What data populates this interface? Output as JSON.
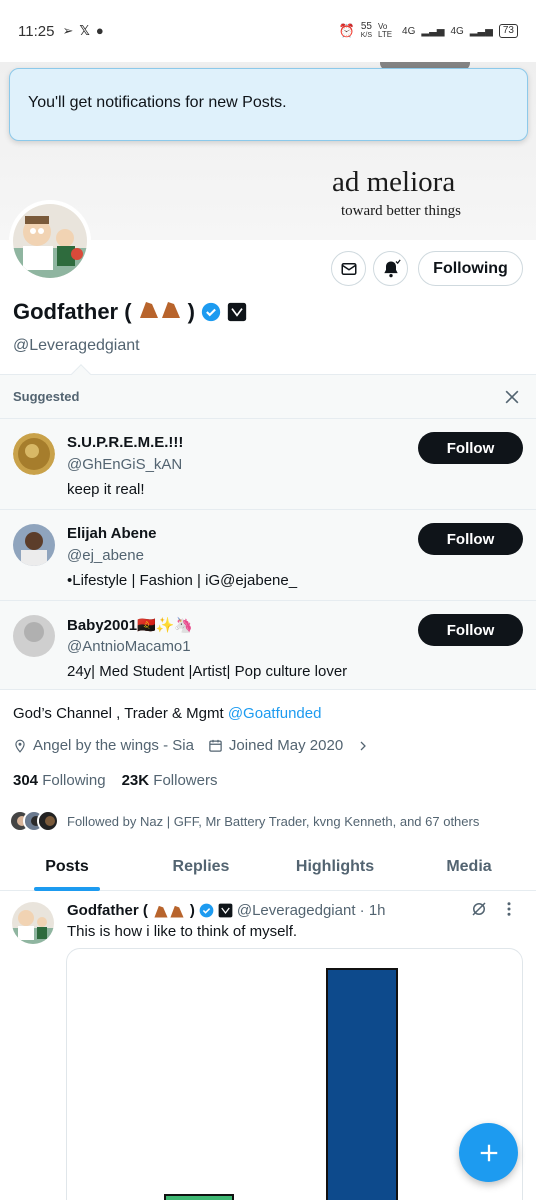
{
  "status_bar": {
    "time": "11:25",
    "network_speed": "55",
    "network_unit": "K/S",
    "volte": "Vo LTE",
    "net1": "4G",
    "net2": "4G",
    "battery": "73"
  },
  "banner": {
    "motto": "ad meliora",
    "motto_sub": "toward better things"
  },
  "toast": {
    "message": "You'll get notifications for new Posts."
  },
  "profile": {
    "name": "Godfather (",
    "name_close": ")",
    "handle": "@Leveragedgiant",
    "following_label": "Following",
    "bio_text": "God’s Channel , Trader & Mgmt ",
    "bio_link": "@Goatfunded",
    "location": "Angel by the wings - Sia",
    "joined": "Joined May 2020",
    "following_count": "304",
    "following_label_stat": "Following",
    "followers_count": "23K",
    "followers_label": "Followers",
    "followed_by": "Followed by Naz | GFF, Mr Battery Trader, kvng Kenneth, and 67 others"
  },
  "suggested": {
    "title": "Suggested",
    "accounts": [
      {
        "name": "S.U.P.R.E.M.E.!!!",
        "handle": "@GhEnGiS_kAN",
        "bio": "keep it real!",
        "button": "Follow"
      },
      {
        "name": "Elijah Abene",
        "handle": "@ej_abene",
        "bio": "•Lifestyle | Fashion | iG@ejabene_",
        "button": "Follow"
      },
      {
        "name": "Baby2001",
        "name_emoji": "🇦🇴✨🦄",
        "handle": "@AntnioMacamo1",
        "bio": "24y| Med Student |Artist| Pop culture lover",
        "button": "Follow"
      }
    ]
  },
  "tabs": [
    "Posts",
    "Replies",
    "Highlights",
    "Media"
  ],
  "post": {
    "author": "Godfather (",
    "author_close": ")",
    "handle_time": "@Leveragedgiant · 1h",
    "text": "This is how i like to think of myself."
  },
  "colors": {
    "accent": "#1d9bf0",
    "bar_blue": "#0d4a8c",
    "bar_green": "#3fb873"
  },
  "icons": [
    "mail-icon",
    "bell-plus-icon",
    "verified-badge-icon",
    "close-icon",
    "location-icon",
    "calendar-icon",
    "chevron-right-icon",
    "grok-icon",
    "more-icon",
    "plus-icon"
  ]
}
